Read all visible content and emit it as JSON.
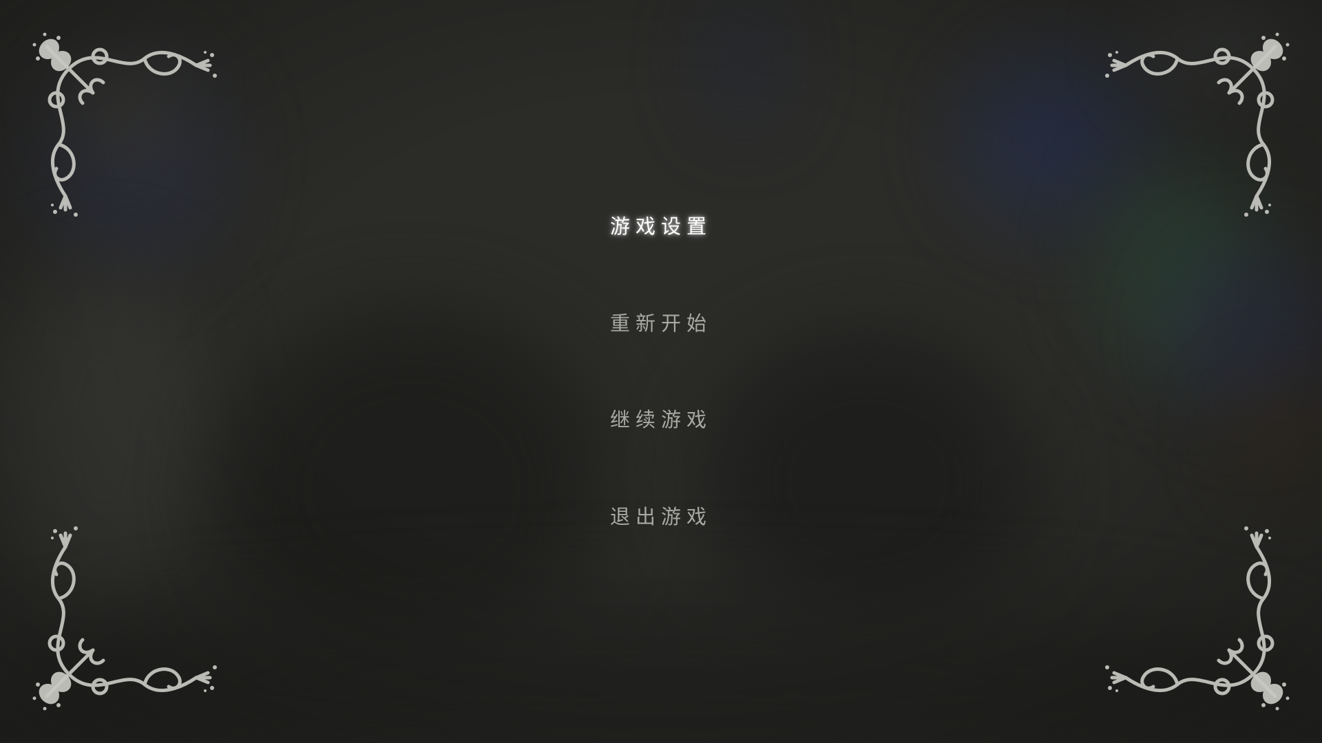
{
  "menu": {
    "items": [
      {
        "label": "游戏设置",
        "selected": true
      },
      {
        "label": "重新开始",
        "selected": false
      },
      {
        "label": "继续游戏",
        "selected": false
      },
      {
        "label": "退出游戏",
        "selected": false
      }
    ]
  },
  "decorations": {
    "corners": [
      "ornate-corner-top-left",
      "ornate-corner-top-right",
      "ornate-corner-bottom-left",
      "ornate-corner-bottom-right"
    ]
  },
  "colors": {
    "background": "#2b2b28",
    "menu_text": "#a9a9a4",
    "menu_text_selected": "#ffffff",
    "ornament": "#c9c9c4"
  }
}
